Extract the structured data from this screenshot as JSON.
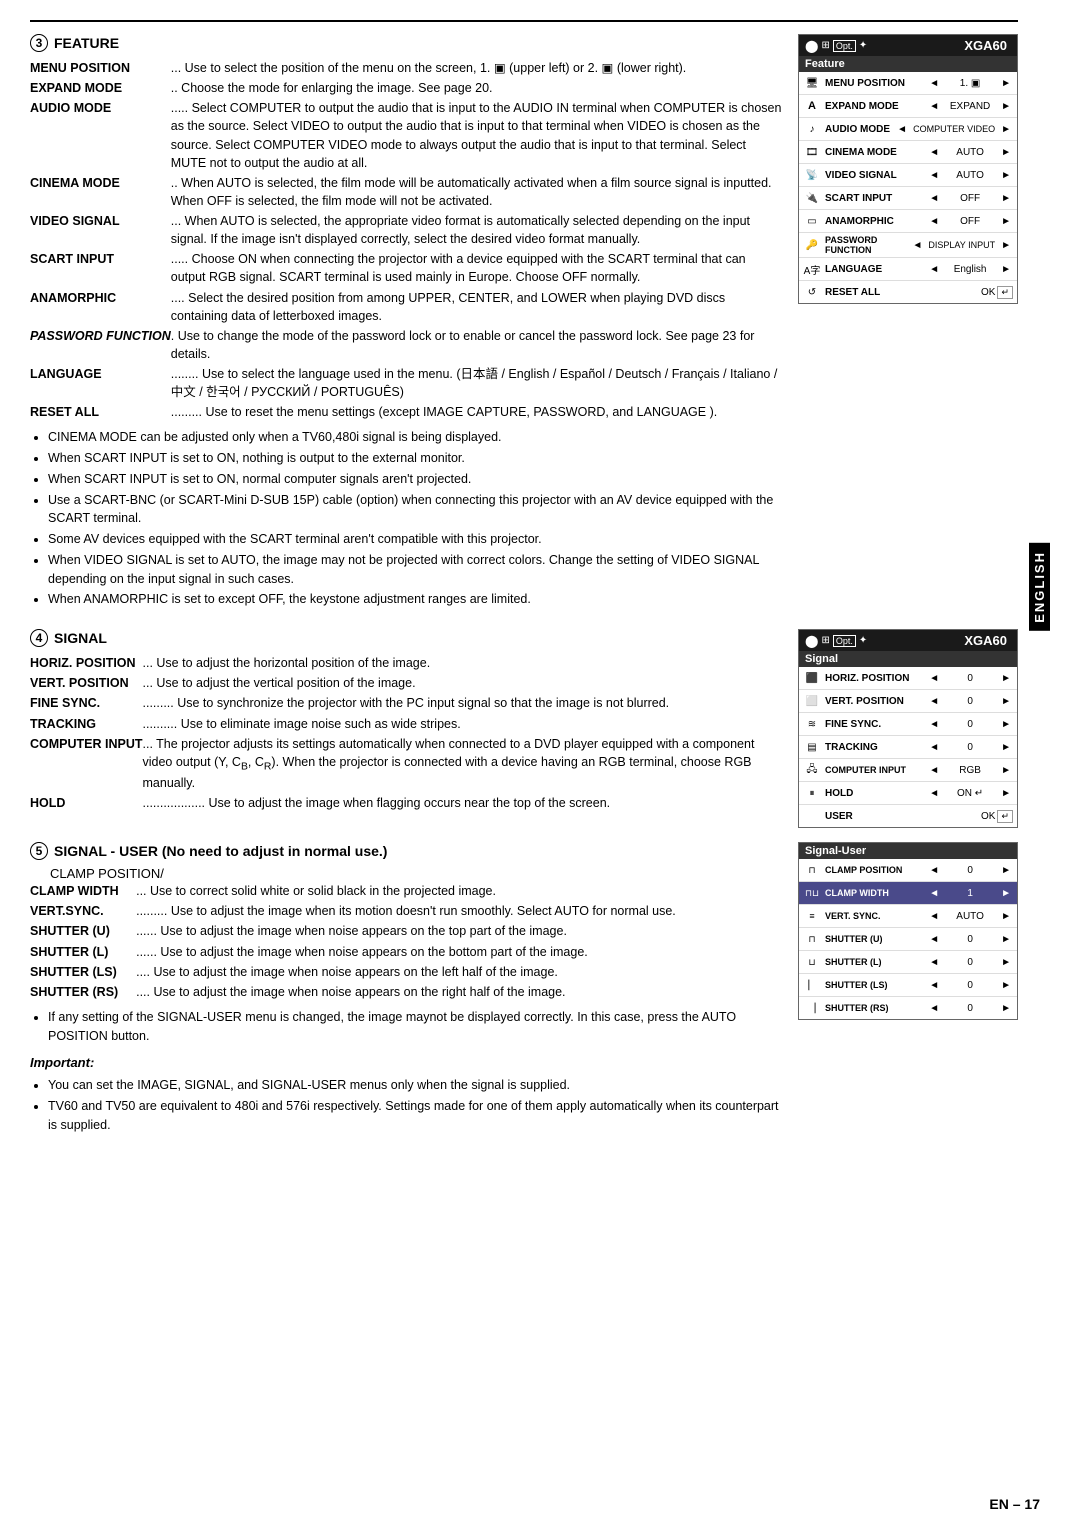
{
  "page": {
    "top_border": true,
    "footer": "EN – 17",
    "english_label": "ENGLISH"
  },
  "section3": {
    "number": "3",
    "title": "FEATURE",
    "entries": [
      {
        "term": "MENU POSITION",
        "desc": "Use to select the position of the menu on the screen,  1. [upper-left icon]  (upper left) or 2. [lower-right icon] (lower right)."
      },
      {
        "term": "EXPAND MODE",
        "desc": "Choose the mode for enlarging the image. See page 20."
      },
      {
        "term": "AUDIO MODE",
        "desc": "Select COMPUTER to output the audio that is input to the AUDIO IN terminal when COMPUTER is chosen as the source. Select VIDEO to output the audio that is input to that terminal when VIDEO is chosen as the source. Select COMPUTER VIDEO mode to always output the audio that is input to that terminal. Select MUTE not to output the audio at all."
      },
      {
        "term": "CINEMA MODE",
        "desc": "When AUTO is selected, the film mode will be automatically activated when a film source signal is inputted. When OFF is selected, the film mode will not be activated."
      },
      {
        "term": "VIDEO SIGNAL",
        "desc": "When AUTO is selected, the appropriate video format is automatically selected depending on the input signal. If the image isn't displayed correctly, select the desired video format manually."
      },
      {
        "term": "SCART INPUT",
        "desc": "Choose ON when connecting the projector with a device equipped with the SCART terminal that can output RGB signal. SCART terminal is used mainly in Europe. Choose OFF normally."
      },
      {
        "term": "ANAMORPHIC",
        "desc": "Select the desired position from among UPPER, CENTER, and LOWER when playing DVD discs containing data of letterboxed images."
      },
      {
        "term": "PASSWORD FUNCTION",
        "desc": "Use to change the mode of the password lock or to enable or cancel the password lock. See page 23 for details.",
        "italic": true
      },
      {
        "term": "LANGUAGE",
        "desc": "Use to select the language used in the menu. (日本語 / English / Español / Deutsch / Français / Italiano / 中文 / 한국어 / РУССКИЙ / PORTUGUÊS)"
      },
      {
        "term": "RESET ALL",
        "desc": "Use to reset the menu settings (except IMAGE CAPTURE, PASSWORD, and LANGUAGE )."
      }
    ],
    "bullets": [
      "CINEMA MODE can be adjusted only when a TV60,480i signal is being displayed.",
      "When SCART INPUT is set to ON, nothing is output to the external monitor.",
      "When SCART INPUT is set to ON, normal computer signals aren't projected.",
      "Use a SCART-BNC (or SCART-Mini D-SUB 15P) cable (option) when connecting this projector with an AV device equipped with the SCART terminal.",
      "Some AV devices equipped with the SCART terminal aren't compatible with this projector.",
      "When VIDEO SIGNAL is set to AUTO, the image may not be projected with correct colors. Change the setting of VIDEO SIGNAL depending on the input signal in such cases.",
      "When ANAMORPHIC is set to except OFF, the keystone adjustment ranges are limited."
    ],
    "menu": {
      "header_title": "XGA60",
      "section_label": "Feature",
      "rows": [
        {
          "icon": "monitor",
          "label": "MENU POSITION",
          "value": "1. [icon]",
          "has_arrows": true
        },
        {
          "icon": "A",
          "label": "EXPAND MODE",
          "value": "EXPAND",
          "has_arrows": true
        },
        {
          "icon": "sound",
          "label": "AUDIO MODE",
          "value": "COMPUTER VIDEO",
          "has_arrows": true
        },
        {
          "icon": "film",
          "label": "CINEMA MODE",
          "value": "AUTO",
          "has_arrows": true
        },
        {
          "icon": "signal",
          "label": "VIDEO SIGNAL",
          "value": "AUTO",
          "has_arrows": true
        },
        {
          "icon": "plug",
          "label": "SCART INPUT",
          "value": "OFF",
          "has_arrows": true
        },
        {
          "icon": "rect",
          "label": "ANAMORPHIC",
          "value": "OFF",
          "has_arrows": true
        },
        {
          "icon": "key",
          "label": "PASSWORD FUNCTION",
          "value": "DISPLAY INPUT",
          "has_arrows": true
        },
        {
          "icon": "globe",
          "label": "LANGUAGE",
          "value": "English",
          "has_arrows": true
        },
        {
          "icon": "reset",
          "label": "RESET ALL",
          "value": "OK [icon]",
          "has_arrows": false
        }
      ]
    }
  },
  "section4": {
    "number": "4",
    "title": "SIGNAL",
    "entries": [
      {
        "term": "HORIZ. POSITION",
        "desc": "Use to adjust the horizontal position of the image."
      },
      {
        "term": "VERT. POSITION",
        "desc": "Use to adjust the vertical position of the image."
      },
      {
        "term": "FINE SYNC.",
        "desc": "Use to synchronize the projector with the PC input signal so that the image is not blurred."
      },
      {
        "term": "TRACKING",
        "desc": "Use to eliminate image noise such as wide stripes."
      },
      {
        "term": "COMPUTER INPUT",
        "desc": "The projector adjusts its settings automatically when connected to a DVD player equipped with a component video output (Y, CB, CR). When the projector is connected with a device having an RGB terminal, choose RGB manually."
      },
      {
        "term": "HOLD",
        "desc": "Use to adjust the image when flagging occurs near the top of the screen."
      }
    ],
    "menu": {
      "header_title": "XGA60",
      "section_label": "Signal",
      "rows": [
        {
          "icon": "horiz",
          "label": "HORIZ. POSITION",
          "value": "0",
          "has_arrows": true
        },
        {
          "icon": "vert",
          "label": "VERT. POSITION",
          "value": "0",
          "has_arrows": true
        },
        {
          "icon": "finesync",
          "label": "FINE SYNC.",
          "value": "0",
          "has_arrows": true
        },
        {
          "icon": "tracking",
          "label": "TRACKING",
          "value": "0",
          "has_arrows": true
        },
        {
          "icon": "computer",
          "label": "COMPUTER INPUT",
          "value": "RGB",
          "has_arrows": true
        },
        {
          "icon": "hold",
          "label": "HOLD",
          "value": "ON [icon]",
          "has_arrows": true
        },
        {
          "icon": "user",
          "label": "USER",
          "value": "OK [icon]",
          "has_arrows": false
        }
      ]
    }
  },
  "section5": {
    "number": "5",
    "title": "SIGNAL - USER (No need to adjust in normal use.)",
    "sub_label": "CLAMP POSITION/",
    "entries": [
      {
        "term": "CLAMP WIDTH",
        "desc": "Use to correct solid white or solid black in the projected image."
      },
      {
        "term": "VERT.SYNC.",
        "desc": "Use to adjust the image when its motion doesn't run smoothly. Select AUTO for normal use."
      },
      {
        "term": "SHUTTER (U)",
        "desc": "Use to adjust the image when noise appears on the top part of the image."
      },
      {
        "term": "SHUTTER (L)",
        "desc": "Use to adjust the image when noise appears on the bottom part of the image."
      },
      {
        "term": "SHUTTER (LS)",
        "desc": "Use to adjust the image when noise appears on the left half of the image."
      },
      {
        "term": "SHUTTER (RS)",
        "desc": "Use to adjust the image when noise appears on the right half of the image."
      }
    ],
    "bullets": [
      "If any setting of the SIGNAL-USER menu is changed, the image maynot be displayed correctly. In this case, press the AUTO POSITION button."
    ],
    "menu": {
      "section_label": "Signal-User",
      "rows": [
        {
          "icon": "clamp_pos",
          "label": "CLAMP POSITION",
          "value": "0",
          "has_arrows": true
        },
        {
          "icon": "clamp_w",
          "label": "CLAMP WIDTH",
          "value": "1",
          "has_arrows": true
        },
        {
          "icon": "vert_sync",
          "label": "VERT. SYNC.",
          "value": "AUTO",
          "has_arrows": true
        },
        {
          "icon": "shutter_u",
          "label": "SHUTTER (U)",
          "value": "0",
          "has_arrows": true
        },
        {
          "icon": "shutter_l",
          "label": "SHUTTER (L)",
          "value": "0",
          "has_arrows": true
        },
        {
          "icon": "shutter_ls",
          "label": "SHUTTER (LS)",
          "value": "0",
          "has_arrows": true
        },
        {
          "icon": "shutter_rs",
          "label": "SHUTTER (RS)",
          "value": "0",
          "has_arrows": true
        }
      ]
    }
  },
  "important": {
    "label": "Important:",
    "bullets": [
      "You can set the IMAGE, SIGNAL, and SIGNAL-USER menus only when the signal is supplied.",
      "TV60 and TV50 are equivalent to 480i and 576i respectively. Settings made for one of them apply automatically when its counterpart is supplied."
    ]
  }
}
